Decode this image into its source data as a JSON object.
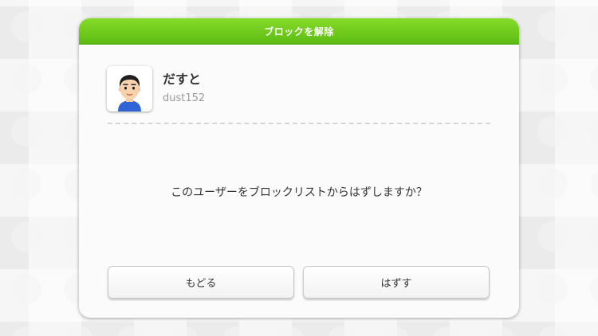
{
  "dialog": {
    "title": "ブロックを解除",
    "message": "このユーザーをブロックリストからはずしますか？",
    "accent_color": "#6ccb1c"
  },
  "user": {
    "name": "だすと",
    "id": "dust152",
    "avatar_icon": "mii-avatar-icon"
  },
  "buttons": {
    "back_label": "もどる",
    "remove_label": "はずす"
  }
}
